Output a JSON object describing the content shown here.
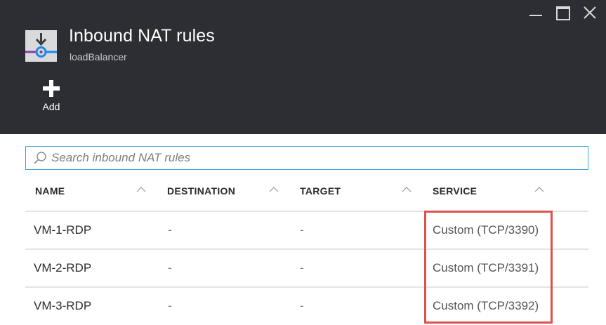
{
  "blade": {
    "title": "Inbound NAT rules",
    "subtitle": "loadBalancer",
    "icon": "load-balancer-icon"
  },
  "window_controls": {
    "minimize": "minimize-icon",
    "maximize": "maximize-icon",
    "close": "close-icon"
  },
  "commands": {
    "add_label": "Add"
  },
  "search": {
    "placeholder": "Search inbound NAT rules",
    "value": ""
  },
  "table": {
    "columns": [
      "NAME",
      "DESTINATION",
      "TARGET",
      "SERVICE"
    ],
    "rows": [
      {
        "name": "VM-1-RDP",
        "destination": "-",
        "target": "-",
        "service": "Custom (TCP/3390)"
      },
      {
        "name": "VM-2-RDP",
        "destination": "-",
        "target": "-",
        "service": "Custom (TCP/3391)"
      },
      {
        "name": "VM-3-RDP",
        "destination": "-",
        "target": "-",
        "service": "Custom (TCP/3392)"
      }
    ]
  },
  "colors": {
    "header_bg": "#2c2e33",
    "search_border": "#3aa7d9",
    "highlight_border": "#d9534f",
    "icon_blue": "#1e88e5",
    "icon_purple": "#8e3aa8"
  }
}
